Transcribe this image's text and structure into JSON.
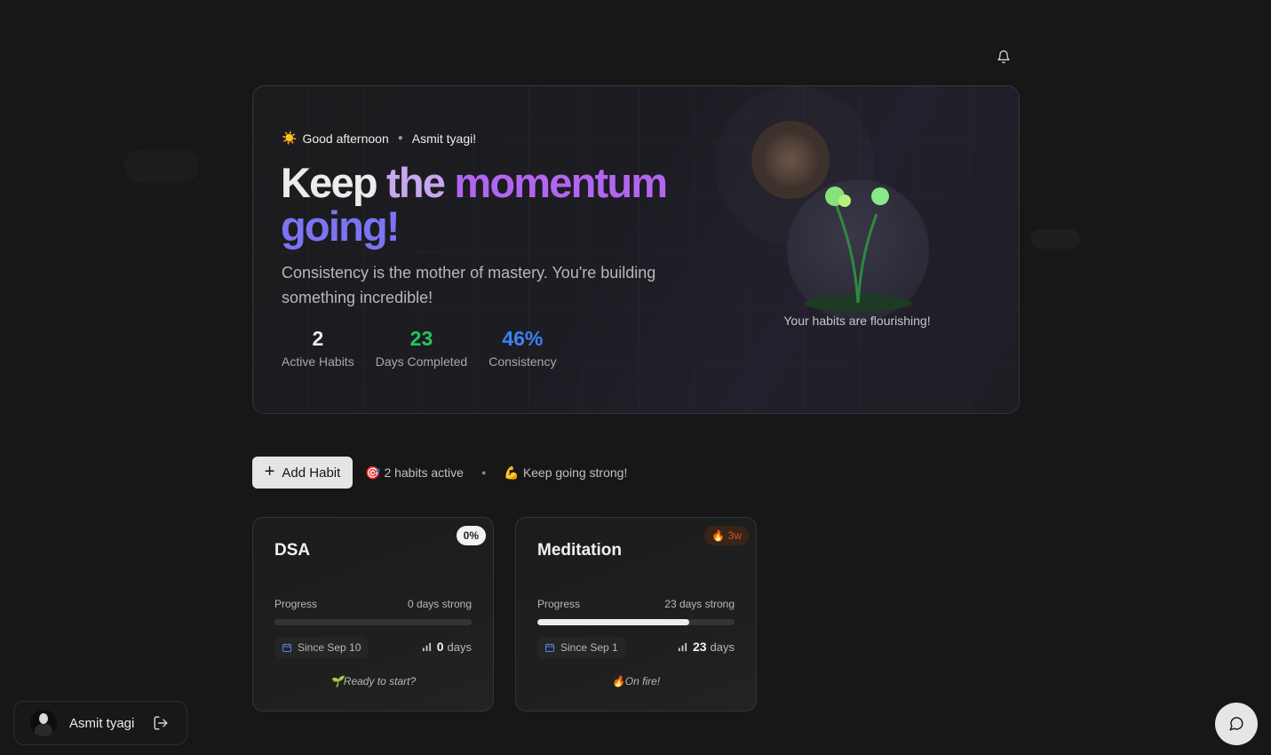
{
  "header": {
    "bell_icon": "bell-icon"
  },
  "hero": {
    "greeting_emoji": "☀️",
    "greeting": "Good afternoon",
    "greeting_name": "Asmit tyagi!",
    "headline": {
      "w1": "Keep",
      "w2": "the",
      "w3": "momentum",
      "w4": "going!"
    },
    "subtitle": "Consistency is the mother of mastery. You're building something incredible!",
    "stats": [
      {
        "value": "2",
        "label": "Active Habits",
        "color": "#ececec"
      },
      {
        "value": "23",
        "label": "Days Completed",
        "color": "#22c55e"
      },
      {
        "value": "46%",
        "label": "Consistency",
        "color": "#3b82f6"
      }
    ],
    "plant_caption": "Your habits are flourishing!"
  },
  "actions": {
    "add_habit_label": "Add Habit",
    "active_emoji": "🎯",
    "active_text": "2 habits active",
    "strong_emoji": "💪",
    "strong_text": "Keep going strong!"
  },
  "habits": [
    {
      "title": "DSA",
      "badge": "0%",
      "progress_label": "Progress",
      "streak_text": "0 days strong",
      "progress": 0,
      "since": "Since Sep 10",
      "days_value": "0",
      "days_unit": "days",
      "footer_emoji": "🌱",
      "footer_text": "Ready to start?"
    },
    {
      "title": "Meditation",
      "badge_emoji": "🔥",
      "badge": "3w",
      "progress_label": "Progress",
      "streak_text": "23 days strong",
      "progress": 0.77,
      "since": "Since Sep 1",
      "days_value": "23",
      "days_unit": "days",
      "footer_emoji": "🔥",
      "footer_text": "On fire!"
    }
  ],
  "user": {
    "name": "Asmit tyagi"
  },
  "colors": {
    "accent_purple": "#b266f0",
    "accent_indigo": "#7c74f2",
    "green": "#22c55e",
    "blue": "#3b82f6",
    "streak_orange": "#c8562a"
  }
}
